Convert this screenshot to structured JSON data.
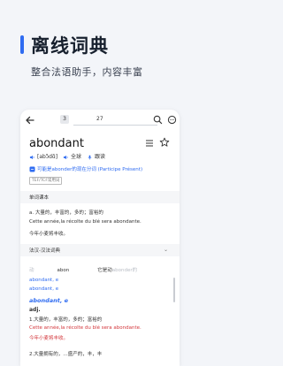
{
  "hero": {
    "title": "离线词典",
    "subtitle": "整合法语助手，内容丰富"
  },
  "toolbar": {
    "page_index": "3",
    "page_total": "27"
  },
  "entry": {
    "headword": "abondant",
    "phonetic": "[abɔ̃dɑ̃]",
    "accent_1": "全球",
    "accent_2": "跟读",
    "hint": "可能是abonder的现在分词 (Participe Présent)",
    "badge": "TEF/TCF常用词"
  },
  "sections": {
    "vocab_title": "单词课本",
    "dict_title": "法汉-汉法词典"
  },
  "vocab": {
    "line1": "a. 大量的，丰富的，多的；富裕的",
    "line2": "Cette année,la récolte du blé sera abondante.",
    "line3": "今年小麦将丰收。"
  },
  "scan": {
    "part1": "动",
    "part2": "abon",
    "part3": "它是动",
    "part4": "abonder",
    "part5": "的"
  },
  "dict": {
    "line1": "abondant, e",
    "line2": "abondant, e",
    "pos": "adj.",
    "sense1": "1.大量的，丰富的，多的；富裕的",
    "ex1": "Cette année,la récolte du blé sera abondante.",
    "ex1_tr": "今年小麦将丰收。",
    "sense2": "2.大量拥有的，…盛产的，丰，丰"
  }
}
